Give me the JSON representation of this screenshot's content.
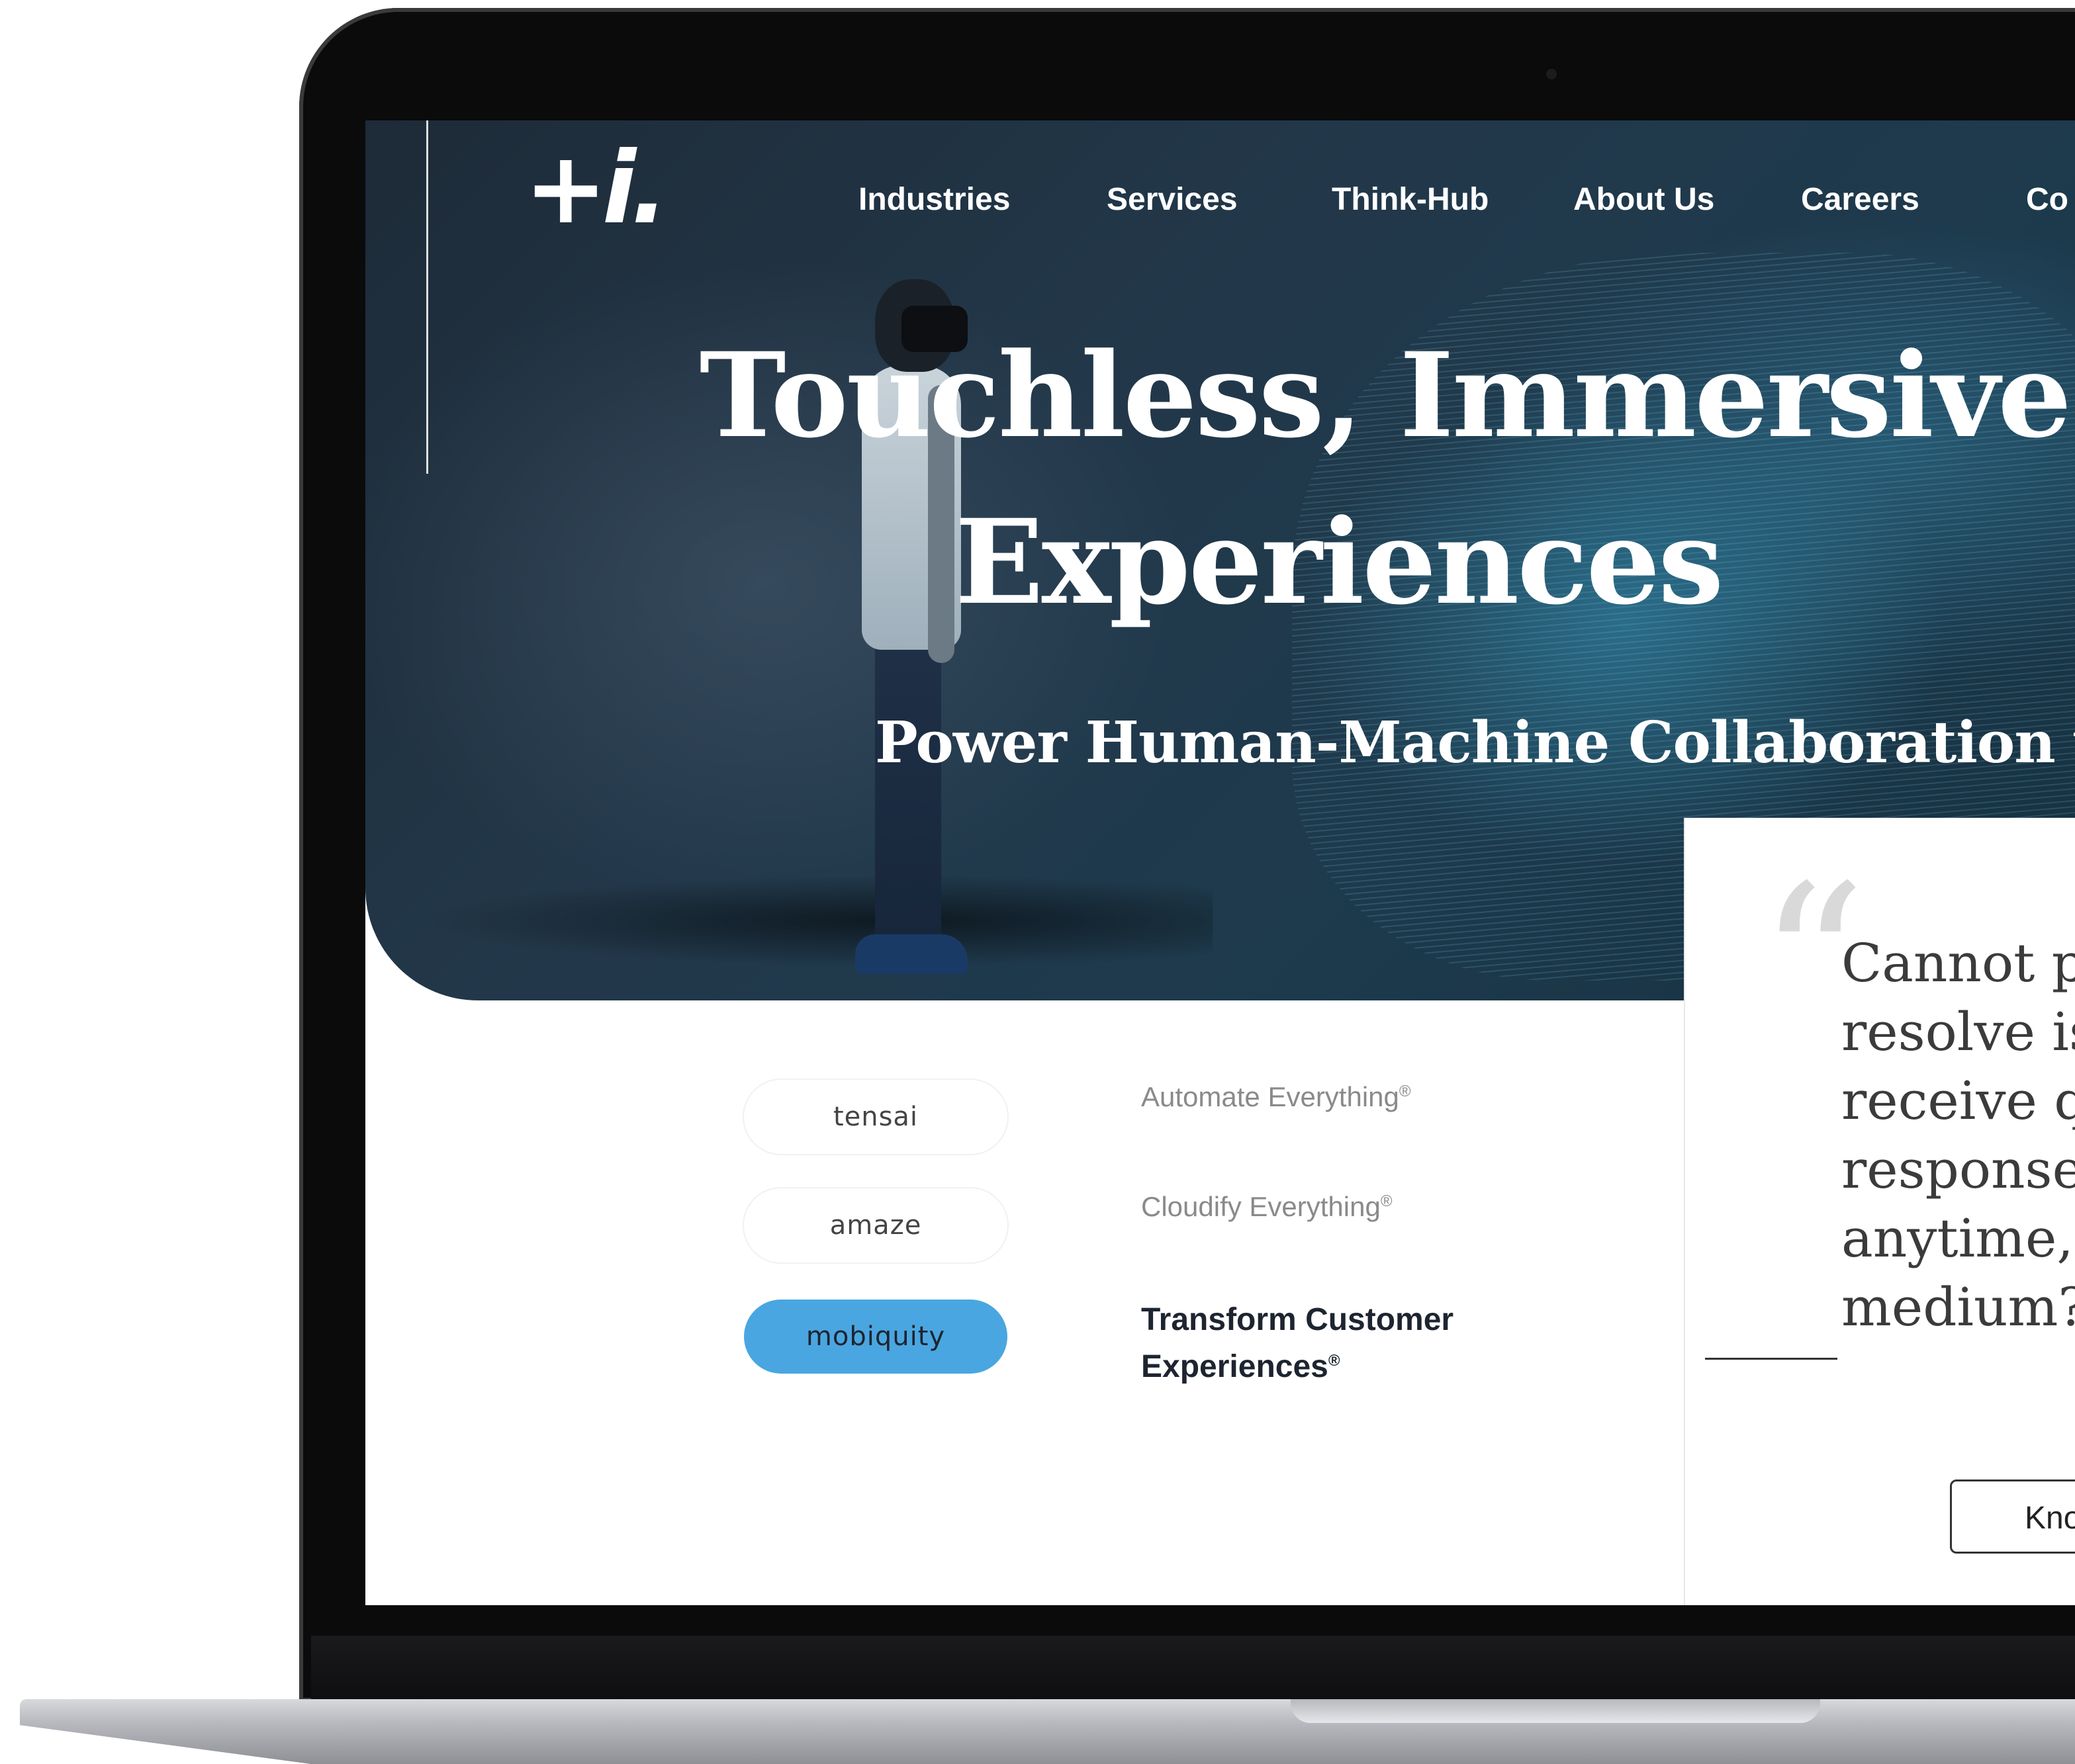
{
  "brand": {
    "logo_text": "+i."
  },
  "nav": {
    "items": [
      "Industries",
      "Services",
      "Think-Hub",
      "About Us",
      "Careers",
      "Co"
    ]
  },
  "hero": {
    "title_line1": "Touchless, Immersive Cu",
    "title_line2": "Experiences",
    "subtitle": "Power Human-Machine Collaboration wi"
  },
  "products": {
    "pills": [
      "tensai",
      "amaze",
      "mobiquity"
    ],
    "taglines": [
      "Automate Everything",
      "Cloudify Everything",
      "Transform Customer Experiences"
    ],
    "registered_mark": "®",
    "active_color": "#4aa6e0"
  },
  "testimonial": {
    "quote_mark": "“",
    "text": "Cannot pl\nresolve is\nreceive qu\nresponses\nanytime, v\nmedium?",
    "button_label": "Kno"
  },
  "icons": {
    "quote": "quote-icon",
    "camera": "camera-icon"
  },
  "colors": {
    "hero_dark": "#1e2b38",
    "hero_teal": "#3696b9",
    "accent_blue": "#4aa6e0",
    "text_dark": "#1e2530",
    "muted": "#8a8a8a"
  }
}
